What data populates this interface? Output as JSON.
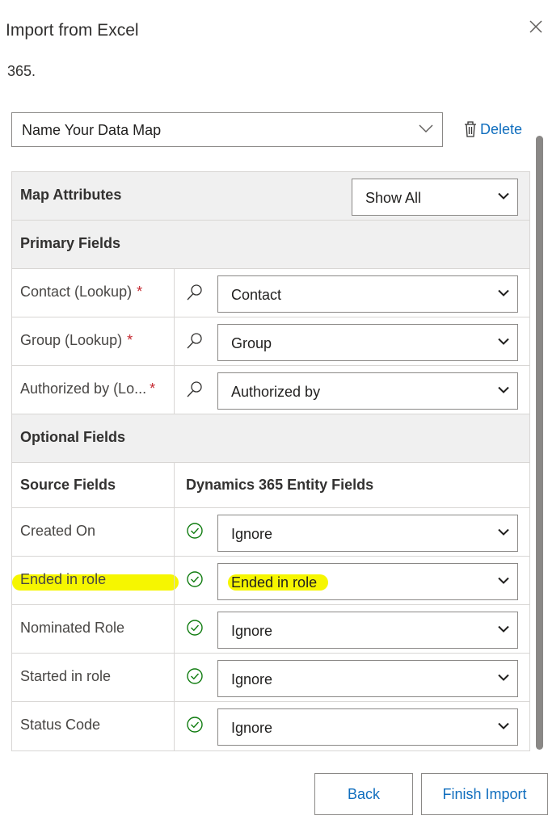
{
  "dialog": {
    "title": "Import from Excel",
    "cut_text": "365."
  },
  "data_map": {
    "value": "Name Your Data Map",
    "delete_label": "Delete"
  },
  "table": {
    "map_attributes_label": "Map Attributes",
    "show_all_value": "Show All",
    "primary_fields_label": "Primary Fields",
    "primary": [
      {
        "source": "Contact (Lookup)",
        "required": "*",
        "target": "Contact"
      },
      {
        "source": "Group (Lookup)",
        "required": "*",
        "target": "Group"
      },
      {
        "source": "Authorized by (Lo...",
        "required": "*",
        "target": "Authorized by"
      }
    ],
    "optional_fields_label": "Optional Fields",
    "source_fields_header": "Source Fields",
    "entity_fields_header": "Dynamics 365 Entity Fields",
    "optional": [
      {
        "source": "Created On",
        "target": "Ignore"
      },
      {
        "source": "Ended in role",
        "target": "Ended in role"
      },
      {
        "source": "Nominated Role",
        "target": "Ignore"
      },
      {
        "source": "Started in role",
        "target": "Ignore"
      },
      {
        "source": "Status Code",
        "target": "Ignore"
      }
    ]
  },
  "footer": {
    "back_label": "Back",
    "finish_label": "Finish Import"
  },
  "colors": {
    "accent": "#106ebe",
    "check": "#107c10",
    "required": "#c4262e",
    "highlight": "#f6f600"
  }
}
